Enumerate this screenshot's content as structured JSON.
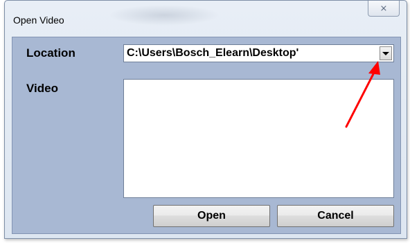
{
  "window": {
    "title": "Open Video",
    "close_glyph": "⨯"
  },
  "form": {
    "location_label": "Location",
    "location_value": "C:\\Users\\Bosch_Elearn\\Desktop'",
    "video_label": "Video"
  },
  "buttons": {
    "open_label": "Open",
    "cancel_label": "Cancel"
  },
  "annotation": {
    "arrow_color": "#ff0000"
  }
}
